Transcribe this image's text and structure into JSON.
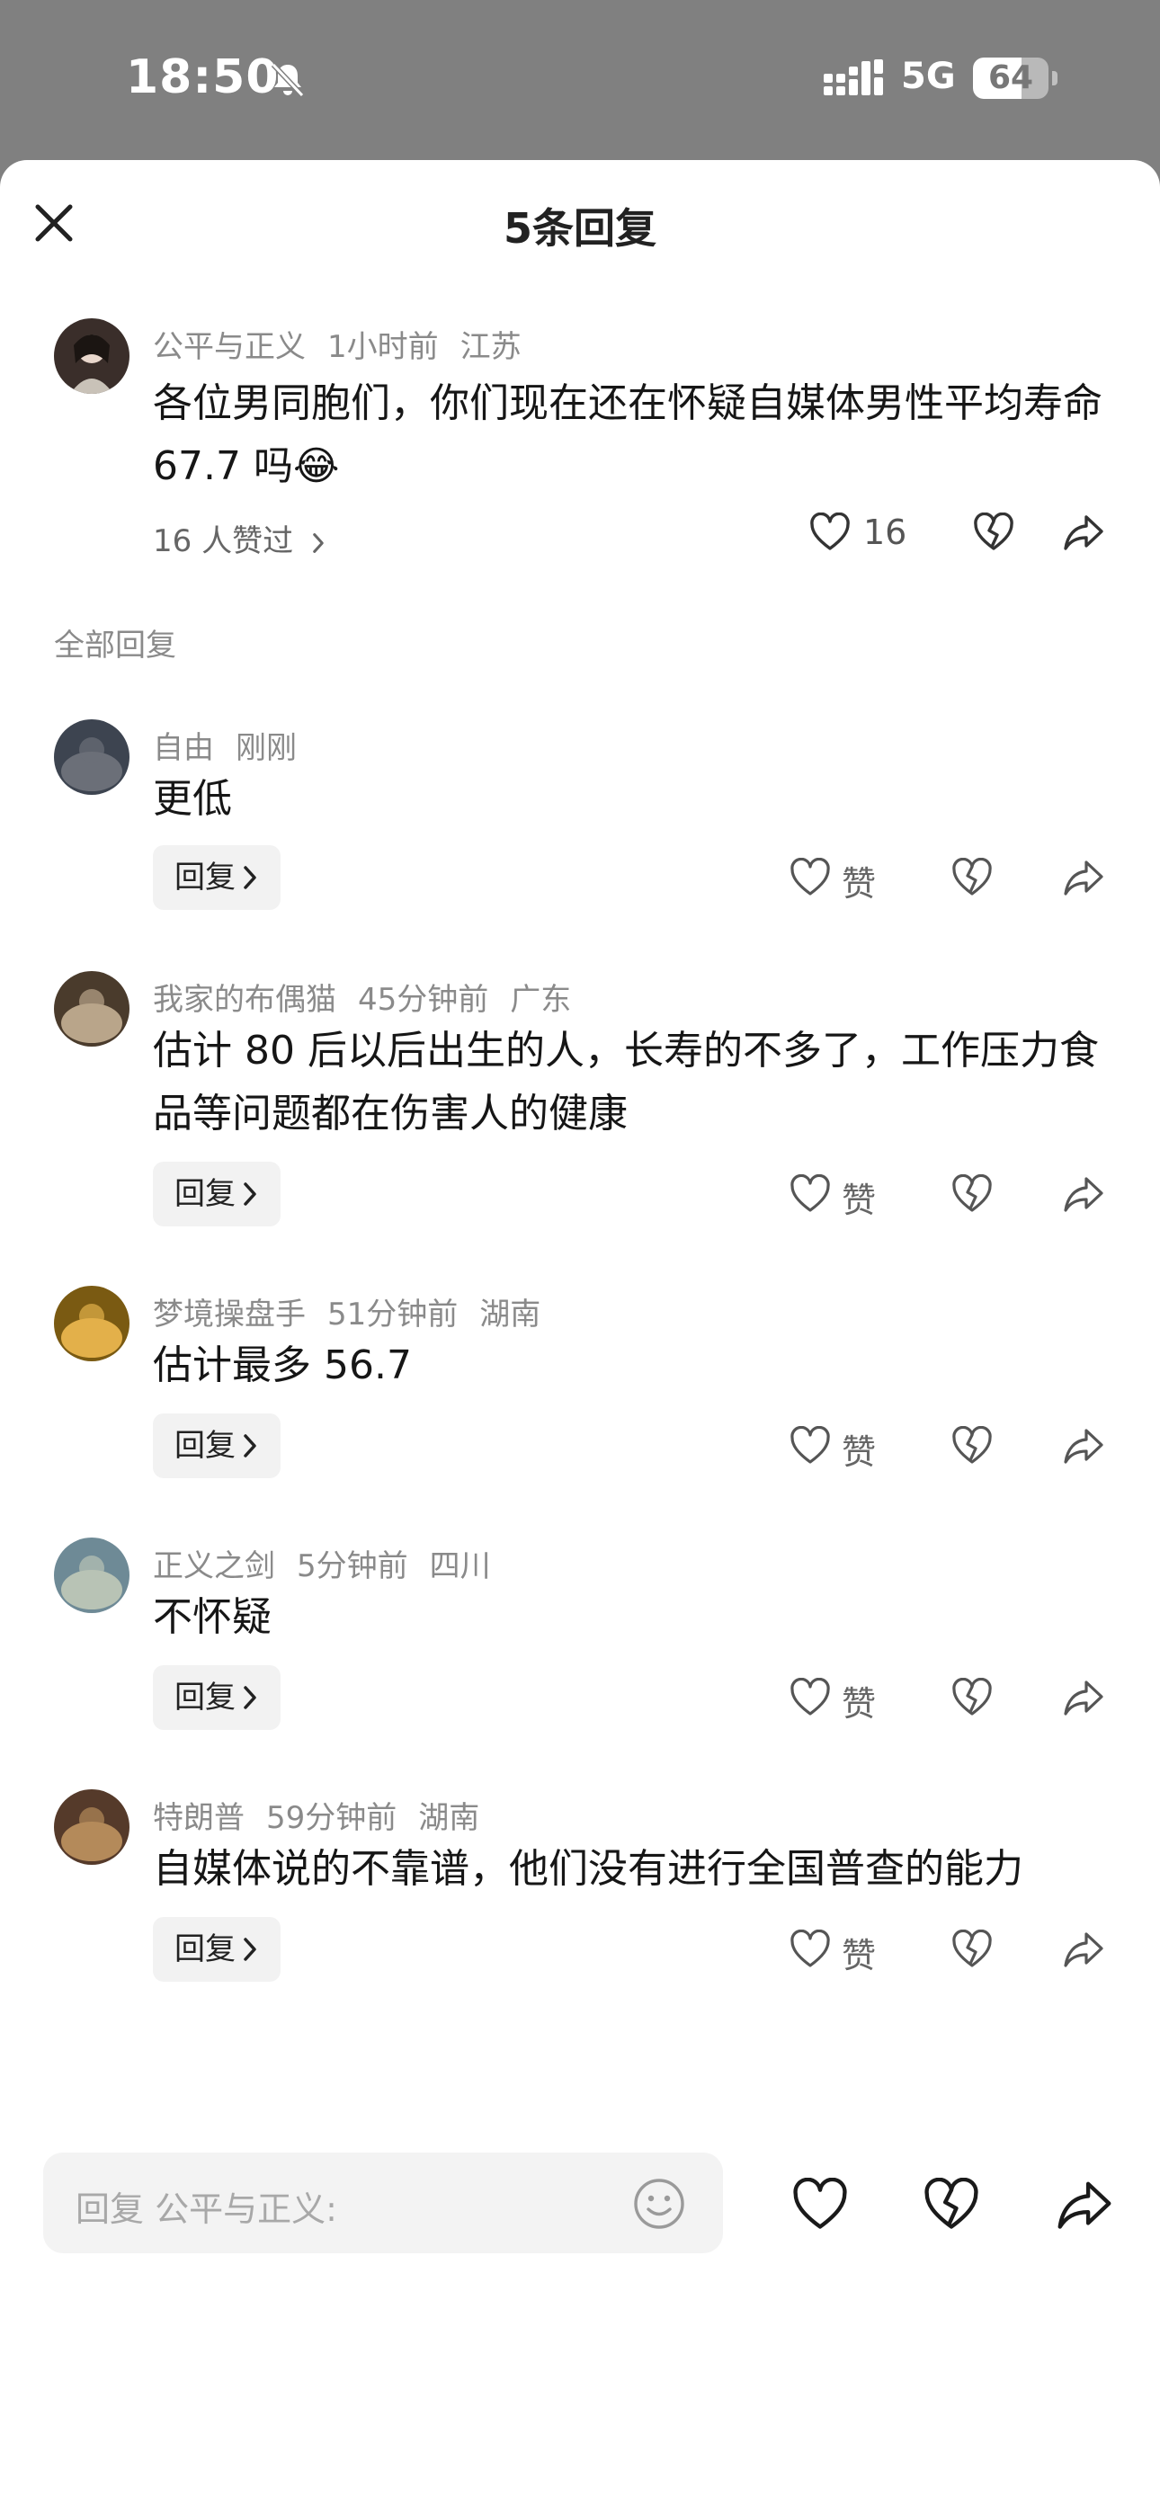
{
  "status_bar": {
    "time": "18:50",
    "network": "5G",
    "battery": "64",
    "battery_level": 0.64
  },
  "header": {
    "title": "5条回复"
  },
  "main_comment": {
    "author": "公平与正义",
    "time": "1小时前",
    "location": "江苏",
    "text": "各位男同胞们，你们现在还在怀疑自媒体男性平均寿命 67.7 吗😂",
    "likers": "16 人赞过",
    "like_count": "16"
  },
  "section_label": "全部回复",
  "reply_button_label": "回复",
  "like_label": "赞",
  "replies": [
    {
      "author": "自由",
      "time": "刚刚",
      "location": "",
      "text": "更低"
    },
    {
      "author": "我家的布偶猫",
      "time": "45分钟前",
      "location": "广东",
      "text": "估计 80 后以后出生的人，长寿的不多了，工作压力食品等问题都在伤害人的健康"
    },
    {
      "author": "梦境操盘手",
      "time": "51分钟前",
      "location": "湖南",
      "text": "估计最多 56.7"
    },
    {
      "author": "正义之剑",
      "time": "5分钟前",
      "location": "四川",
      "text": "不怀疑"
    },
    {
      "author": "特朗普",
      "time": "59分钟前",
      "location": "湖南",
      "text": "自媒体说的不靠谱，他们没有进行全国普查的能力"
    }
  ],
  "bottom_bar": {
    "placeholder": "回复 公平与正义:"
  },
  "icons": [
    "close-icon",
    "bell-muted-icon",
    "signal-icon",
    "battery-icon",
    "heart-icon",
    "broken-heart-icon",
    "share-icon",
    "chevron-right-icon",
    "emoji-icon"
  ]
}
